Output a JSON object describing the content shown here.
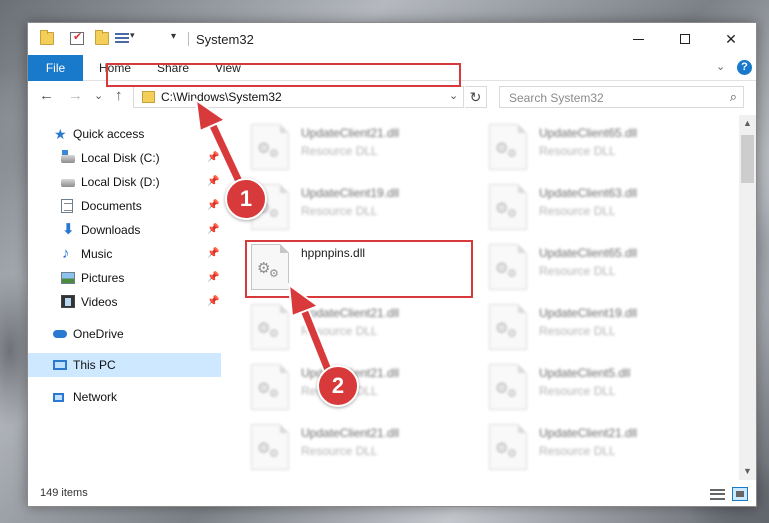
{
  "window": {
    "title": "System32",
    "controls": {
      "minimize": "",
      "maximize": "",
      "close": "✕"
    }
  },
  "ribbon": {
    "tabs": [
      "File",
      "Home",
      "Share",
      "View"
    ],
    "collapse_glyph": "⌄",
    "help_glyph": "?"
  },
  "nav": {
    "back_glyph": "←",
    "forward_glyph": "→",
    "recent_glyph": "⌄",
    "up_glyph": "↑",
    "address": "C:\\Windows\\System32",
    "address_chevron": "⌄",
    "refresh_glyph": "↻",
    "search_placeholder": "Search System32",
    "search_glyph": "⌕"
  },
  "sidebar": {
    "items": [
      {
        "label": "Quick access",
        "icon": "star-icon"
      },
      {
        "label": "Local Disk (C:)",
        "icon": "drive-c-icon",
        "pinned": true
      },
      {
        "label": "Local Disk (D:)",
        "icon": "drive-d-icon",
        "pinned": true
      },
      {
        "label": "Documents",
        "icon": "documents-icon",
        "pinned": true
      },
      {
        "label": "Downloads",
        "icon": "downloads-icon",
        "pinned": true
      },
      {
        "label": "Music",
        "icon": "music-icon",
        "pinned": true
      },
      {
        "label": "Pictures",
        "icon": "pictures-icon",
        "pinned": true
      },
      {
        "label": "Videos",
        "icon": "videos-icon",
        "pinned": true
      },
      {
        "label": "OneDrive",
        "icon": "onedrive-icon"
      },
      {
        "label": "This PC",
        "icon": "this-pc-icon",
        "selected": true
      },
      {
        "label": "Network",
        "icon": "network-icon"
      }
    ],
    "pin_glyph": "📌"
  },
  "files": {
    "left_column": [
      {
        "name": "UpdateClient21.dll",
        "type": "Resource DLL"
      },
      {
        "name": "UpdateClient19.dll",
        "type": "Resource DLL"
      },
      {
        "name": "hppnpins.dll",
        "type": ""
      },
      {
        "name": "UpdateClient21.dll",
        "type": "Resource DLL"
      },
      {
        "name": "UpdateClient21.dll",
        "type": "Resource DLL"
      },
      {
        "name": "UpdateClient21.dll",
        "type": "Resource DLL"
      }
    ],
    "right_column": [
      {
        "name": "UpdateClient65.dll",
        "type": "Resource DLL"
      },
      {
        "name": "UpdateClient63.dll",
        "type": "Resource DLL"
      },
      {
        "name": "UpdateClient65.dll",
        "type": "Resource DLL"
      },
      {
        "name": "UpdateClient19.dll",
        "type": "Resource DLL"
      },
      {
        "name": "UpdateClient5.dll",
        "type": "Resource DLL"
      },
      {
        "name": "UpdateClient21.dll",
        "type": "Resource DLL"
      }
    ],
    "highlighted_name": "hppnpins.dll"
  },
  "scrollbar": {
    "up_glyph": "▲",
    "down_glyph": "▼"
  },
  "status": {
    "item_count": "149 items"
  },
  "annotations": {
    "step1": "1",
    "step2": "2",
    "color": "#d8393a"
  }
}
